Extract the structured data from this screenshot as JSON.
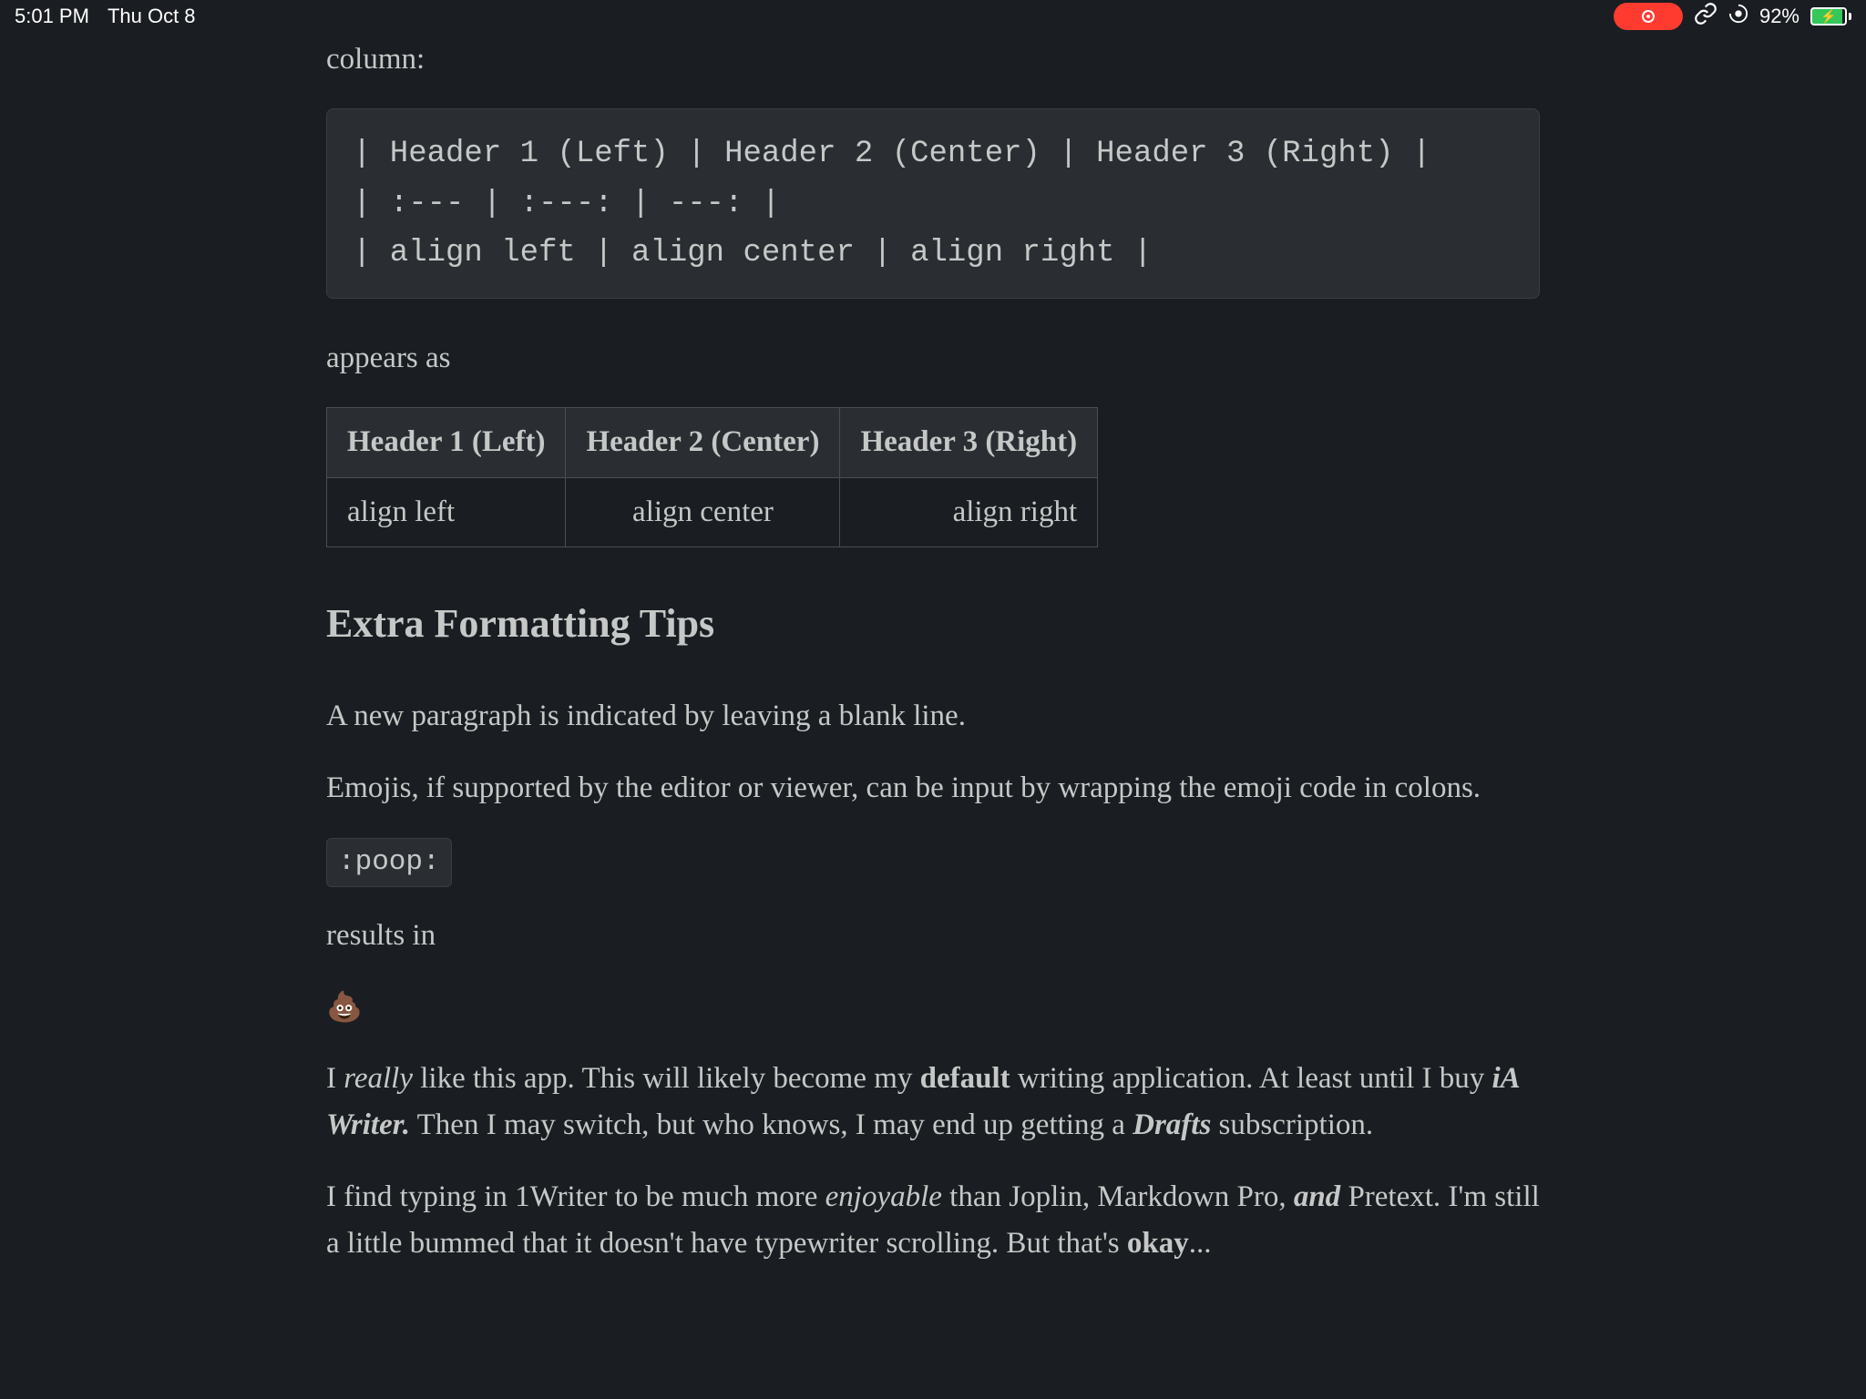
{
  "status_bar": {
    "time": "5:01 PM",
    "date": "Thu Oct 8",
    "battery_percent": "92%"
  },
  "content": {
    "intro_fragment": "column:",
    "code_block": "| Header 1 (Left) | Header 2 (Center) | Header 3 (Right) |\n| :--- | :---: | ---: |\n| align left | align center | align right |",
    "appears_as": "appears as",
    "table": {
      "headers": [
        "Header 1 (Left)",
        "Header 2 (Center)",
        "Header 3 (Right)"
      ],
      "row": [
        "align left",
        "align center",
        "align right"
      ]
    },
    "heading": "Extra Formatting Tips",
    "para1": "A new paragraph is indicated by leaving a blank line.",
    "para2": "Emojis, if supported by the editor or viewer, can be input by wrapping the emoji code in colons.",
    "emoji_code": ":poop:",
    "results_in": "results in",
    "emoji": "💩",
    "para3": {
      "t1": "I ",
      "t2_em": "really",
      "t3": " like this app. This will likely become my ",
      "t4_strong": "default",
      "t5": " writing application. At least until I buy ",
      "t6_bi": "iA Writer.",
      "t7": " Then I may switch, but who knows, I may end up getting a ",
      "t8_bi": "Drafts",
      "t9": " subscription."
    },
    "para4": {
      "t1": "I find typing in 1Writer to be much more ",
      "t2_em": "enjoyable",
      "t3": " than Joplin, Markdown Pro, ",
      "t4_bi": "and",
      "t5": " Pretext. I'm still a little bummed that it doesn't have typewriter scrolling. But that's ",
      "t6_strong": "okay",
      "t7": "..."
    }
  }
}
